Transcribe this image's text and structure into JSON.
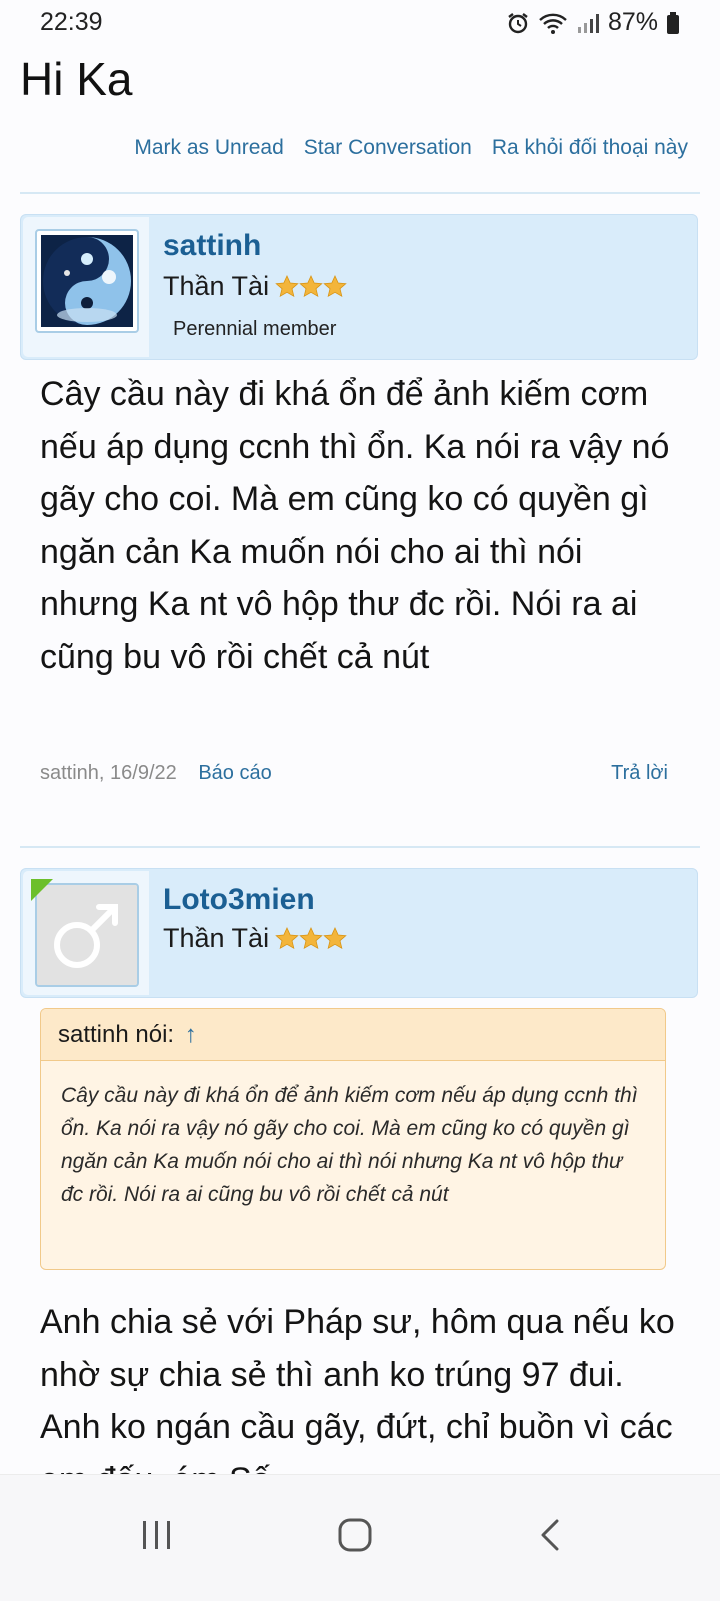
{
  "status_bar": {
    "time": "22:39",
    "battery": "87%",
    "icons": [
      "alarm-icon",
      "wifi-icon",
      "signal-icon",
      "battery-icon"
    ]
  },
  "page": {
    "title": "Hi Ka"
  },
  "actions": {
    "mark_unread": "Mark as Unread",
    "star_conversation": "Star Conversation",
    "leave_conversation": "Ra khỏi đối thoại này"
  },
  "posts": [
    {
      "username": "sattinh",
      "user_title": "Thần Tài",
      "stars": 3,
      "extra_title": "Perennial member",
      "text": "Cây cầu này đi khá ổn để ảnh kiếm cơm nếu áp dụng ccnh thì ổn. Ka nói ra vậy nó gãy cho coi. Mà em cũng ko có quyền gì ngăn cản Ka muốn nói cho ai thì nói nhưng Ka nt vô hộp thư đc rồi. Nói ra ai cũng bu vô rồi chết cả nút",
      "meta": "sattinh, 16/9/22",
      "report": "Báo cáo",
      "reply": "Trả lời"
    },
    {
      "username": "Loto3mien",
      "user_title": "Thần Tài",
      "stars": 3,
      "quote": {
        "header": "sattinh nói:",
        "arrow": "↑",
        "text": "Cây cầu này đi khá ổn để ảnh kiếm cơm nếu áp dụng ccnh thì ổn. Ka nói ra vậy nó gãy cho coi. Mà em cũng ko có quyền gì ngăn cản Ka muốn nói cho ai thì nói nhưng Ka nt vô hộp thư đc rồi. Nói ra ai cũng bu vô rồi chết cả nút"
      },
      "text": "Anh chia sẻ với Pháp sư, hôm qua nếu ko nhờ sự chia sẻ thì anh ko trúng 97 đui. Anh ko ngán cầu gãy, đứt, chỉ buồn vì các em đấu, ém Số"
    }
  ],
  "nav": {
    "icons": [
      "recent-apps-icon",
      "home-icon",
      "back-icon"
    ]
  },
  "colors": {
    "link": "#2c6f9e",
    "username": "#1b5f93",
    "card_bg": "#d9ecfa",
    "quote_bg": "#fff4e4",
    "quote_border": "#f1c98a"
  }
}
